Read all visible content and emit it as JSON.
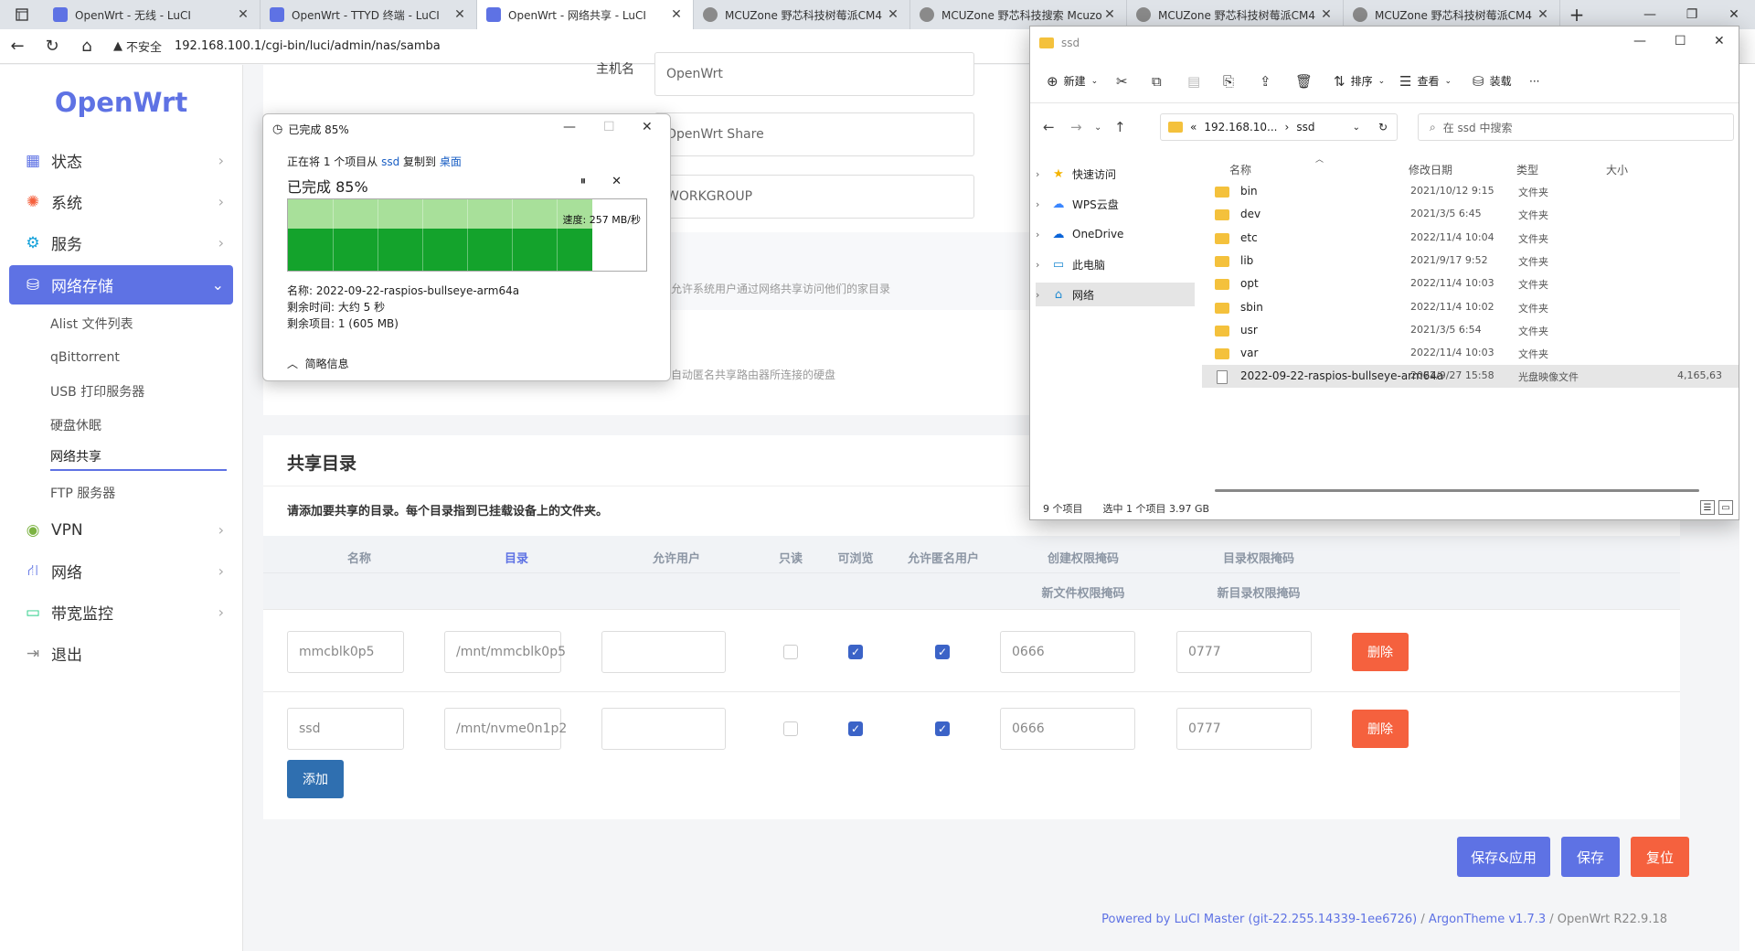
{
  "browser": {
    "tabs": [
      {
        "title": "OpenWrt - 无线 - LuCI",
        "active": false,
        "icon": "luci"
      },
      {
        "title": "OpenWrt - TTYD 终端 - LuCI",
        "active": false,
        "icon": "luci"
      },
      {
        "title": "OpenWrt - 网络共享 - LuCI",
        "active": true,
        "icon": "luci"
      },
      {
        "title": "MCUZone 野芯科技树莓派CM4",
        "active": false,
        "icon": "mcu"
      },
      {
        "title": "MCUZone 野芯科技搜索 Mcuzo",
        "active": false,
        "icon": "mcu"
      },
      {
        "title": "MCUZone 野芯科技树莓派CM4",
        "active": false,
        "icon": "mcu"
      },
      {
        "title": "MCUZone 野芯科技树莓派CM4",
        "active": false,
        "icon": "mcu"
      }
    ],
    "security_label": "不安全",
    "url": "192.168.100.1/cgi-bin/luci/admin/nas/samba"
  },
  "sidebar": {
    "logo": "OpenWrt",
    "items": [
      {
        "label": "状态",
        "icon": "dashboard-icon"
      },
      {
        "label": "系统",
        "icon": "gear-icon"
      },
      {
        "label": "服务",
        "icon": "services-icon"
      },
      {
        "label": "网络存储",
        "icon": "storage-icon",
        "active": true
      },
      {
        "label": "VPN",
        "icon": "vpn-icon"
      },
      {
        "label": "网络",
        "icon": "network-icon"
      },
      {
        "label": "带宽监控",
        "icon": "monitor-icon"
      },
      {
        "label": "退出",
        "icon": "logout-icon"
      }
    ],
    "submenu": [
      "Alist 文件列表",
      "qBittorrent",
      "USB 打印服务器",
      "硬盘休眠",
      "网络共享",
      "FTP 服务器"
    ]
  },
  "form": {
    "hostname_label": "主机名",
    "hostname": "OpenWrt",
    "description": "OpenWrt Share",
    "workgroup": "WORKGROUP",
    "homes_hint": "允许系统用户通过网络共享访问他们的家目录",
    "autoshare_hint": "自动匿名共享路由器所连接的硬盘"
  },
  "shares": {
    "title": "共享目录",
    "description": "请添加要共享的目录。每个目录指到已挂载设备上的文件夹。",
    "columns": {
      "name": "名称",
      "path": "目录",
      "users": "允许用户",
      "read_only": "只读",
      "browseable": "可浏览",
      "guest": "允许匿名用户",
      "create_mask": "创建权限掩码",
      "dir_mask": "目录权限掩码",
      "file_mask": "新文件权限掩码",
      "new_dir_mask": "新目录权限掩码"
    },
    "rows": [
      {
        "name": "mmcblk0p5",
        "path": "/mnt/mmcblk0p5",
        "users": "",
        "read_only": false,
        "browseable": true,
        "guest": true,
        "create_mask": "0666",
        "dir_mask": "0777",
        "delete": "删除"
      },
      {
        "name": "ssd",
        "path": "/mnt/nvme0n1p2",
        "users": "",
        "read_only": false,
        "browseable": true,
        "guest": true,
        "create_mask": "0666",
        "dir_mask": "0777",
        "delete": "删除"
      }
    ],
    "add_label": "添加"
  },
  "actions": {
    "save_apply": "保存&应用",
    "save": "保存",
    "reset": "复位",
    "colors": {
      "save_apply": "#5e72e4",
      "save": "#5e72e4",
      "reset": "#f5613e"
    }
  },
  "footer": {
    "powered": "Powered by LuCI Master (git-22.255.14339-1ee6726)",
    "sep1": " / ",
    "theme": "ArgonTheme v1.7.3",
    "sep2": " / ",
    "version": "OpenWrt R22.9.18"
  },
  "copy_dialog": {
    "title": "已完成 85%",
    "line_prefix": "正在将 1 个项目从",
    "source": "ssd",
    "line_mid": "复制到",
    "dest": "桌面",
    "percent_text": "已完成 85%",
    "progress": 0.85,
    "speed": "速度: 257 MB/秒",
    "name_line": "名称: 2022-09-22-raspios-bullseye-arm64a",
    "remaining_time": "剩余时间: 大约 5 秒",
    "remaining_items": "剩余项目: 1 (605 MB)",
    "less_info": "简略信息"
  },
  "explorer": {
    "title": "ssd",
    "toolbar": {
      "new": "新建",
      "sort": "排序",
      "view": "查看",
      "mount": "装载",
      "more": "···"
    },
    "path": [
      "«",
      "192.168.10...",
      "›",
      "ssd"
    ],
    "search_placeholder": "在 ssd 中搜索",
    "nav": [
      {
        "label": "快速访问",
        "icon": "star-icon"
      },
      {
        "label": "WPS云盘",
        "icon": "cloud-icon"
      },
      {
        "label": "OneDrive",
        "icon": "onedrive-icon"
      },
      {
        "label": "此电脑",
        "icon": "pc-icon"
      },
      {
        "label": "网络",
        "icon": "network-icon",
        "selected": true
      }
    ],
    "columns": {
      "name": "名称",
      "date": "修改日期",
      "type": "类型",
      "size": "大小"
    },
    "files": [
      {
        "name": "bin",
        "date": "2021/10/12 9:15",
        "type": "文件夹",
        "size": ""
      },
      {
        "name": "dev",
        "date": "2021/3/5 6:45",
        "type": "文件夹",
        "size": ""
      },
      {
        "name": "etc",
        "date": "2022/11/4 10:04",
        "type": "文件夹",
        "size": ""
      },
      {
        "name": "lib",
        "date": "2021/9/17 9:52",
        "type": "文件夹",
        "size": ""
      },
      {
        "name": "opt",
        "date": "2022/11/4 10:03",
        "type": "文件夹",
        "size": ""
      },
      {
        "name": "sbin",
        "date": "2022/11/4 10:02",
        "type": "文件夹",
        "size": ""
      },
      {
        "name": "usr",
        "date": "2021/3/5 6:54",
        "type": "文件夹",
        "size": ""
      },
      {
        "name": "var",
        "date": "2022/11/4 10:03",
        "type": "文件夹",
        "size": ""
      },
      {
        "name": "2022-09-22-raspios-bullseye-arm64a",
        "date": "2022/9/27 15:58",
        "type": "光盘映像文件",
        "size": "4,165,63",
        "selected": true
      }
    ],
    "status": {
      "count": "9 个项目",
      "selected": "选中 1 个项目  3.97 GB"
    }
  }
}
